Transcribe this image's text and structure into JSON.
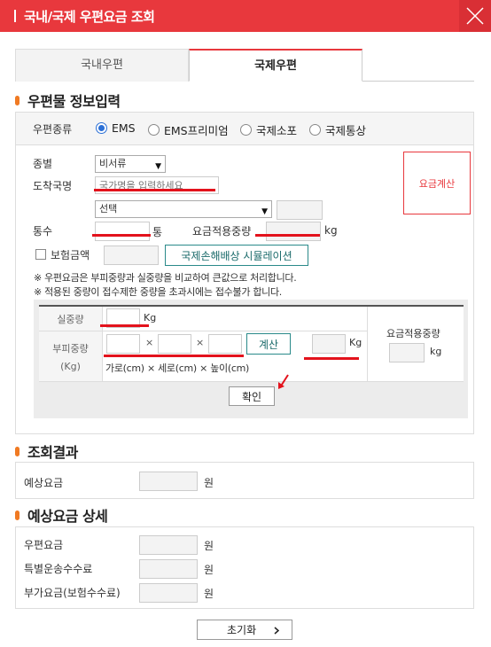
{
  "window": {
    "title": "국내/국제 우편요금 조회"
  },
  "tabs": [
    {
      "label": "국내우편",
      "active": false
    },
    {
      "label": "국제우편",
      "active": true
    }
  ],
  "section_info": {
    "title": "우편물 정보입력"
  },
  "mail_type": {
    "label": "우편종류",
    "options": [
      "EMS",
      "EMS프리미엄",
      "국제소포",
      "국제통상"
    ],
    "selected": "EMS"
  },
  "form": {
    "kind_label": "종별",
    "kind_value": "비서류",
    "country_label": "도착국명",
    "country_placeholder": "국가명을 입력하세요",
    "country_select_value": "선택",
    "count_label": "통수",
    "count_unit": "통",
    "applied_weight_label": "요금적용중량",
    "applied_weight_unit": "kg",
    "insurance_label": "보험금액",
    "simulation_button": "국제손해배상 시뮬레이션",
    "calc_button": "요금계산"
  },
  "notes": [
    "※ 우편요금은 부피중량과 실중량을 비교하여 큰값으로 처리합니다.",
    "※ 적용된 중량이 접수제한 중량을 초과시에는 접수불가 합니다."
  ],
  "calculator": {
    "actual_weight_label": "실중량",
    "actual_weight_unit": "Kg",
    "volume_label_line1": "부피중량",
    "volume_label_line2": "(Kg)",
    "times": "×",
    "compute_button": "계산",
    "volume_unit": "Kg",
    "dims_hint": "가로(cm) × 세로(cm) × 높이(cm)",
    "applied_label": "요금적용중량",
    "applied_unit": "kg",
    "confirm_button": "확인"
  },
  "section_result": {
    "title": "조회결과",
    "expected_fee_label": "예상요금",
    "unit": "원"
  },
  "section_detail": {
    "title": "예상요금 상세",
    "rows": [
      {
        "label": "우편요금",
        "unit": "원"
      },
      {
        "label": "특별운송수수료",
        "unit": "원"
      },
      {
        "label": "부가요금(보험수수료)",
        "unit": "원"
      }
    ]
  },
  "reset_button": "초기화",
  "colors": {
    "brand": "#e8383d",
    "accent": "#f07a23",
    "annotation": "#e3121c",
    "radio": "#2a6fd6"
  }
}
